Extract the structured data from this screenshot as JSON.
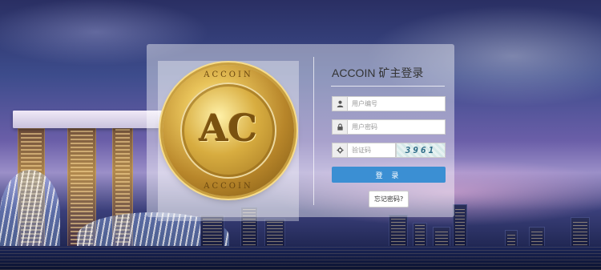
{
  "login": {
    "title": "ACCOIN 矿主登录",
    "username_placeholder": "用户编号",
    "password_placeholder": "用户密码",
    "captcha_placeholder": "验证码",
    "captcha_text": "3961",
    "submit_label": "登 录",
    "forgot_label": "忘记密码?"
  },
  "coin": {
    "top_text": "ACCOIN",
    "monogram": "AC",
    "bottom_text": "ACCOIN"
  },
  "icons": {
    "username": "user-icon",
    "password": "lock-icon",
    "captcha": "gear-icon"
  },
  "colors": {
    "primary_button": "#3b8fd3"
  }
}
